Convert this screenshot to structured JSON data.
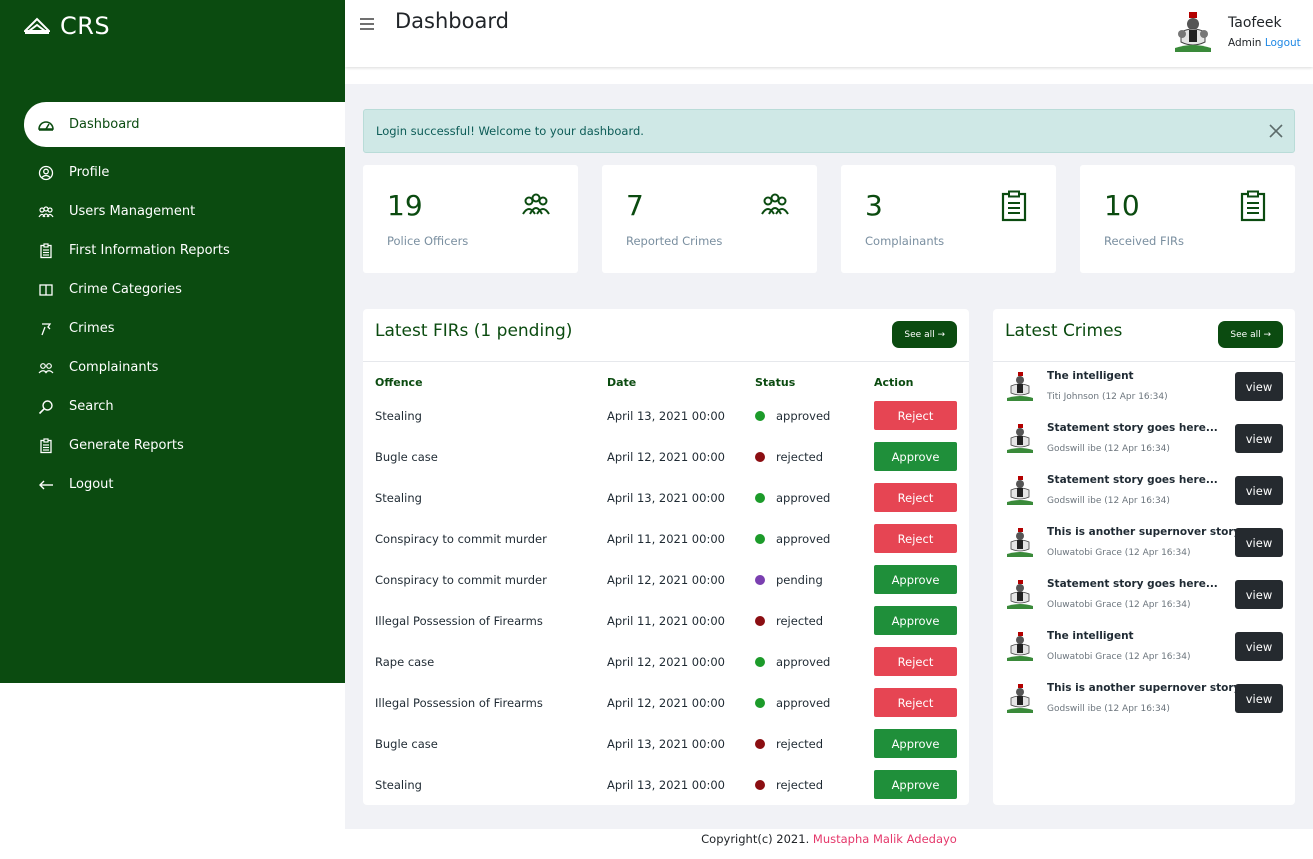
{
  "brand": {
    "name": "CRS"
  },
  "sidebar": {
    "items": [
      {
        "label": "Dashboard",
        "icon": "dashboard-icon"
      },
      {
        "label": "Profile",
        "icon": "user-circle-icon"
      },
      {
        "label": "Users Management",
        "icon": "users-icon"
      },
      {
        "label": "First Information Reports",
        "icon": "clipboard-icon"
      },
      {
        "label": "Crime Categories",
        "icon": "book-icon"
      },
      {
        "label": "Crimes",
        "icon": "crime-icon"
      },
      {
        "label": "Complainants",
        "icon": "people-icon"
      },
      {
        "label": "Search",
        "icon": "search-icon"
      },
      {
        "label": "Generate Reports",
        "icon": "report-icon"
      },
      {
        "label": "Logout",
        "icon": "arrow-left-icon"
      }
    ]
  },
  "header": {
    "title": "Dashboard",
    "user_name": "Taofeek",
    "user_role": "Admin",
    "logout_label": "Logout"
  },
  "alert": {
    "message": "Login successful! Welcome to your dashboard."
  },
  "stats": [
    {
      "value": "19",
      "label": "Police Officers",
      "icon": "officers-icon"
    },
    {
      "value": "7",
      "label": "Reported Crimes",
      "icon": "crimes-group-icon"
    },
    {
      "value": "3",
      "label": "Complainants",
      "icon": "clipboard-list-icon"
    },
    {
      "value": "10",
      "label": "Received FIRs",
      "icon": "clipboard-list-icon"
    }
  ],
  "firs": {
    "title": "Latest FIRs (1 pending)",
    "see_all": "See all →",
    "columns": [
      "Offence",
      "Date",
      "Status",
      "Action"
    ],
    "rows": [
      {
        "offence": "Stealing",
        "date": "April 13, 2021 00:00",
        "status": "approved",
        "action": "Reject"
      },
      {
        "offence": "Bugle case",
        "date": "April 12, 2021 00:00",
        "status": "rejected",
        "action": "Approve"
      },
      {
        "offence": "Stealing",
        "date": "April 13, 2021 00:00",
        "status": "approved",
        "action": "Reject"
      },
      {
        "offence": "Conspiracy to commit murder",
        "date": "April 11, 2021 00:00",
        "status": "approved",
        "action": "Reject"
      },
      {
        "offence": "Conspiracy to commit murder",
        "date": "April 12, 2021 00:00",
        "status": "pending",
        "action": "Approve"
      },
      {
        "offence": "Illegal Possession of Firearms",
        "date": "April 11, 2021 00:00",
        "status": "rejected",
        "action": "Approve"
      },
      {
        "offence": "Rape case",
        "date": "April 12, 2021 00:00",
        "status": "approved",
        "action": "Reject"
      },
      {
        "offence": "Illegal Possession of Firearms",
        "date": "April 12, 2021 00:00",
        "status": "approved",
        "action": "Reject"
      },
      {
        "offence": "Bugle case",
        "date": "April 13, 2021 00:00",
        "status": "rejected",
        "action": "Approve"
      },
      {
        "offence": "Stealing",
        "date": "April 13, 2021 00:00",
        "status": "rejected",
        "action": "Approve"
      }
    ]
  },
  "crimes": {
    "title": "Latest Crimes",
    "see_all": "See all →",
    "items": [
      {
        "title": "The intelligent",
        "meta": "Titi Johnson (12 Apr 16:34)",
        "button": "view"
      },
      {
        "title": "Statement story goes here...",
        "meta": "Godswill ibe (12 Apr 16:34)",
        "button": "view"
      },
      {
        "title": "Statement story goes here...",
        "meta": "Godswill ibe (12 Apr 16:34)",
        "button": "view"
      },
      {
        "title": "This is another supernover story",
        "meta": "Oluwatobi Grace (12 Apr 16:34)",
        "button": "view"
      },
      {
        "title": "Statement story goes here...",
        "meta": "Oluwatobi Grace (12 Apr 16:34)",
        "button": "view"
      },
      {
        "title": "The intelligent",
        "meta": "Oluwatobi Grace (12 Apr 16:34)",
        "button": "view"
      },
      {
        "title": "This is another supernover story",
        "meta": "Godswill ibe (12 Apr 16:34)",
        "button": "view"
      }
    ]
  },
  "footer": {
    "prefix": "Copyright(c) 2021.",
    "author": "Mustapha Malik Adedayo"
  },
  "colors": {
    "primary": "#0b4b10",
    "approved": "#1c9b2a",
    "rejected": "#8b0e12",
    "pending": "#7a3fb0",
    "reject_button": "#e64553",
    "approve_button": "#1f8f3a"
  }
}
